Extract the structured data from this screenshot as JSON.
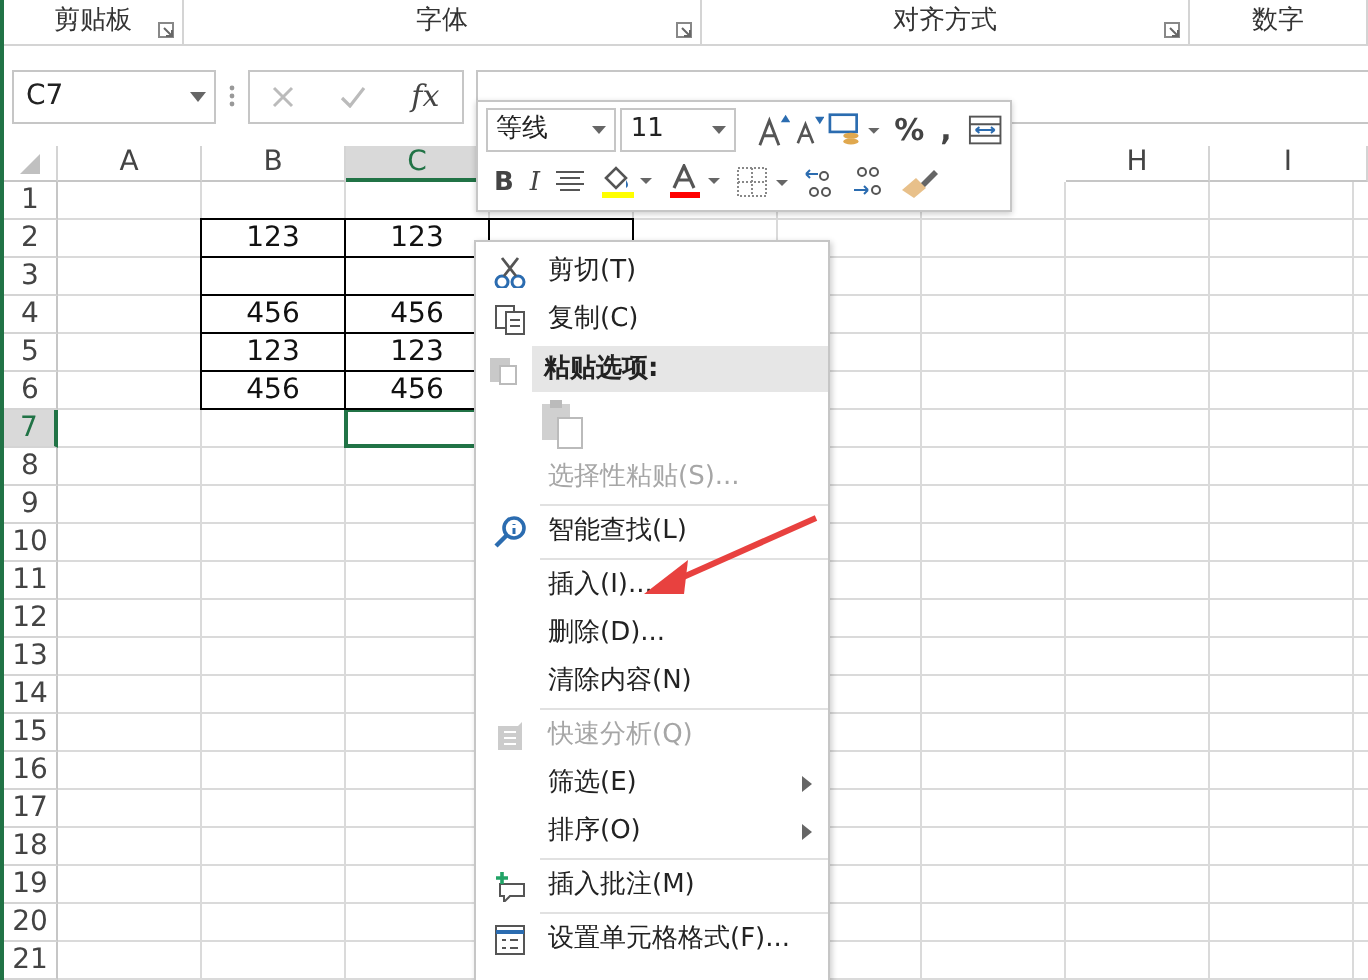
{
  "ribbon_groups": [
    {
      "label": "剪贴板",
      "launcher": true
    },
    {
      "label": "字体",
      "launcher": true
    },
    {
      "label": "对齐方式",
      "launcher": true
    },
    {
      "label": "数字",
      "launcher": false
    }
  ],
  "formula_bar": {
    "name_box": "C7",
    "fx": "fx"
  },
  "columns": [
    {
      "label": "A",
      "selected": false
    },
    {
      "label": "B",
      "selected": false
    },
    {
      "label": "C",
      "selected": true
    },
    {
      "label": "H",
      "selected": false
    },
    {
      "label": "I",
      "selected": false
    }
  ],
  "rows": [
    {
      "label": "1",
      "selected": false
    },
    {
      "label": "2",
      "selected": false
    },
    {
      "label": "3",
      "selected": false
    },
    {
      "label": "4",
      "selected": false
    },
    {
      "label": "5",
      "selected": false
    },
    {
      "label": "6",
      "selected": false
    },
    {
      "label": "7",
      "selected": true
    },
    {
      "label": "8",
      "selected": false
    },
    {
      "label": "9",
      "selected": false
    },
    {
      "label": "10",
      "selected": false
    },
    {
      "label": "11",
      "selected": false
    },
    {
      "label": "12",
      "selected": false
    },
    {
      "label": "13",
      "selected": false
    },
    {
      "label": "14",
      "selected": false
    },
    {
      "label": "15",
      "selected": false
    },
    {
      "label": "16",
      "selected": false
    },
    {
      "label": "17",
      "selected": false
    },
    {
      "label": "18",
      "selected": false
    },
    {
      "label": "19",
      "selected": false
    },
    {
      "label": "20",
      "selected": false
    },
    {
      "label": "21",
      "selected": false
    }
  ],
  "table": [
    {
      "kind": "values",
      "cells": [
        "123",
        "123"
      ]
    },
    {
      "kind": "empty"
    },
    {
      "kind": "values",
      "cells": [
        "456",
        "456"
      ]
    },
    {
      "kind": "values",
      "cells": [
        "123",
        "123"
      ]
    },
    {
      "kind": "values",
      "cells": [
        "456",
        "456"
      ]
    }
  ],
  "mini_toolbar": {
    "font": "等线",
    "size": "11",
    "percent": "%",
    "comma": ",",
    "bold": "B",
    "italic": "I"
  },
  "context_menu": [
    {
      "kind": "item",
      "label": "剪切(T)",
      "disabled": false,
      "submenu": false
    },
    {
      "kind": "item",
      "label": "复制(C)",
      "disabled": false,
      "submenu": false
    },
    {
      "kind": "header",
      "label": "粘贴选项:"
    },
    {
      "kind": "paste"
    },
    {
      "kind": "item",
      "label": "选择性粘贴(S)...",
      "disabled": true,
      "submenu": false
    },
    {
      "kind": "separator"
    },
    {
      "kind": "item",
      "label": "智能查找(L)",
      "disabled": false,
      "submenu": false
    },
    {
      "kind": "separator"
    },
    {
      "kind": "item",
      "label": "插入(I)...",
      "disabled": false,
      "submenu": false
    },
    {
      "kind": "item",
      "label": "删除(D)...",
      "disabled": false,
      "submenu": false
    },
    {
      "kind": "item",
      "label": "清除内容(N)",
      "disabled": false,
      "submenu": false
    },
    {
      "kind": "separator"
    },
    {
      "kind": "item",
      "label": "快速分析(Q)",
      "disabled": true,
      "submenu": false
    },
    {
      "kind": "item",
      "label": "筛选(E)",
      "disabled": false,
      "submenu": true
    },
    {
      "kind": "item",
      "label": "排序(O)",
      "disabled": false,
      "submenu": true
    },
    {
      "kind": "separator"
    },
    {
      "kind": "item",
      "label": "插入批注(M)",
      "disabled": false,
      "submenu": false
    },
    {
      "kind": "separator"
    },
    {
      "kind": "item",
      "label": "设置单元格格式(F)...",
      "disabled": false,
      "submenu": false
    }
  ]
}
